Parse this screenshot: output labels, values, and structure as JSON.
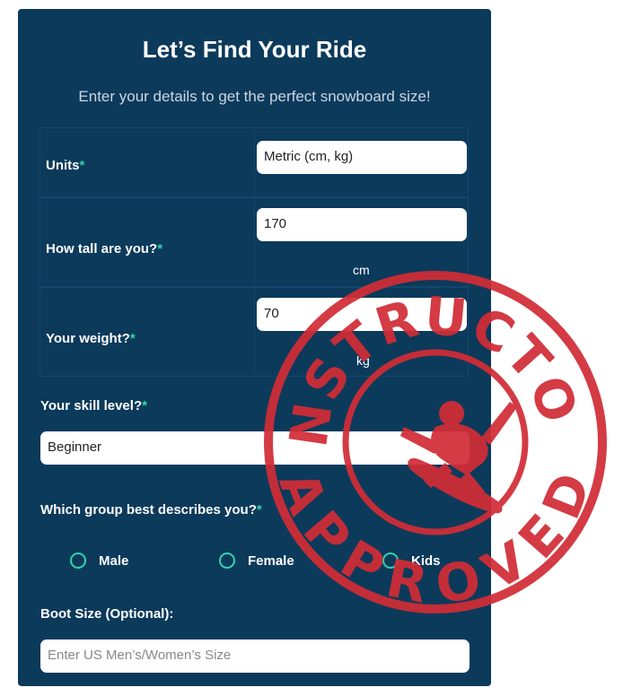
{
  "form": {
    "title": "Let’s Find Your Ride",
    "subtitle": "Enter your details to get the perfect snowboard size!",
    "required_marker": "*",
    "units": {
      "label": "Units",
      "value": "Metric (cm, kg)"
    },
    "height": {
      "label": "How tall are you?",
      "value": "170",
      "unit": "cm"
    },
    "weight": {
      "label": "Your weight?",
      "value": "70",
      "unit": "kg"
    },
    "skill": {
      "label": "Your skill level?",
      "value": "Beginner"
    },
    "group": {
      "label": "Which group best describes you?",
      "options": [
        "Male",
        "Female",
        "Kids"
      ]
    },
    "boot": {
      "label": "Boot Size (Optional):",
      "placeholder": "Enter US Men’s/Women’s Size"
    }
  },
  "stamp": {
    "top_text": "INSTRUCTOR",
    "bottom_text": "APPROVED",
    "color": "#d12d36",
    "icon": "snowboarder-icon"
  },
  "colors": {
    "panel": "#0c3a5b",
    "accent": "#2fd3b0"
  }
}
